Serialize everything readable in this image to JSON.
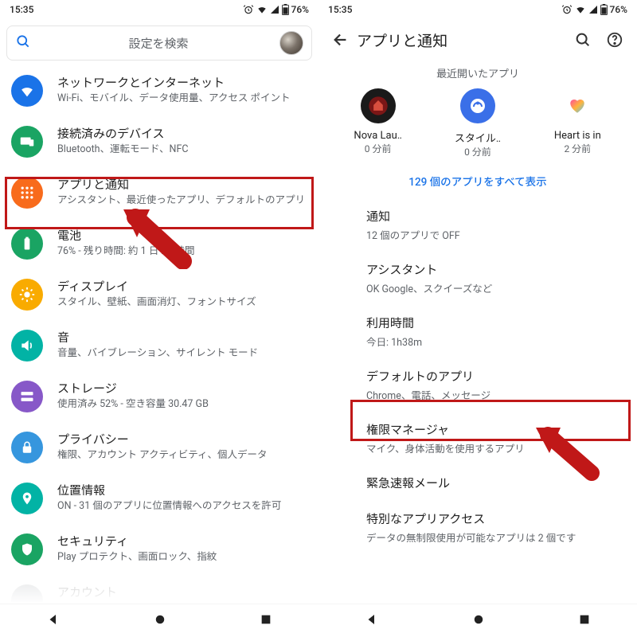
{
  "status": {
    "time": "15:35",
    "battery": "76%"
  },
  "screen1": {
    "search_placeholder": "設定を検索",
    "items": [
      {
        "icon_bg": "#1a73e8",
        "title": "ネットワークとインターネット",
        "sub": "Wi-Fi、モバイル、データ使用量、アクセス ポイント"
      },
      {
        "icon_bg": "#1aa463",
        "title": "接続済みのデバイス",
        "sub": "Bluetooth、運転モード、NFC"
      },
      {
        "icon_bg": "#f86b1c",
        "title": "アプリと通知",
        "sub": "アシスタント、最近使ったアプリ、デフォルトのアプリ"
      },
      {
        "icon_bg": "#1aa463",
        "title": "電池",
        "sub": "76% - 残り時間: 約 1 日 22 時間"
      },
      {
        "icon_bg": "#f9ab00",
        "title": "ディスプレイ",
        "sub": "スタイル、壁紙、画面消灯、フォントサイズ"
      },
      {
        "icon_bg": "#02b3a5",
        "title": "音",
        "sub": "音量、バイブレーション、サイレント モード"
      },
      {
        "icon_bg": "#8758c8",
        "title": "ストレージ",
        "sub": "使用済み 52% - 空き容量 30.47 GB"
      },
      {
        "icon_bg": "#3696de",
        "title": "プライバシー",
        "sub": "権限、アカウント アクティビティ、個人データ"
      },
      {
        "icon_bg": "#02b3a5",
        "title": "位置情報",
        "sub": "ON - 31 個のアプリに位置情報へのアクセスを許可"
      },
      {
        "icon_bg": "#1aa463",
        "title": "セキュリティ",
        "sub": "Play プロテクト、画面ロック、指紋"
      },
      {
        "icon_bg": "#9aa0a6",
        "title": "アカウント",
        "sub": ""
      }
    ]
  },
  "screen2": {
    "header": "アプリと通知",
    "recent_title": "最近開いたアプリ",
    "recent": [
      {
        "name": "Nova Lau‥",
        "time": "0 分前"
      },
      {
        "name": "スタイル‥",
        "time": "0 分前"
      },
      {
        "name": "Heart is in",
        "time": "2 分前"
      }
    ],
    "show_all": "129 個のアプリをすべて表示",
    "rows": [
      {
        "title": "通知",
        "sub": "12 個のアプリで OFF"
      },
      {
        "title": "アシスタント",
        "sub": "OK Google、スクイーズなど"
      },
      {
        "title": "利用時間",
        "sub": "今日: 1h38m"
      },
      {
        "title": "デフォルトのアプリ",
        "sub": "Chrome、電話、メッセージ"
      },
      {
        "title": "権限マネージャ",
        "sub": "マイク、身体活動を使用するアプリ"
      },
      {
        "title": "緊急速報メール",
        "sub": ""
      },
      {
        "title": "特別なアプリアクセス",
        "sub": "データの無制限使用が可能なアプリは 2 個です"
      }
    ]
  }
}
